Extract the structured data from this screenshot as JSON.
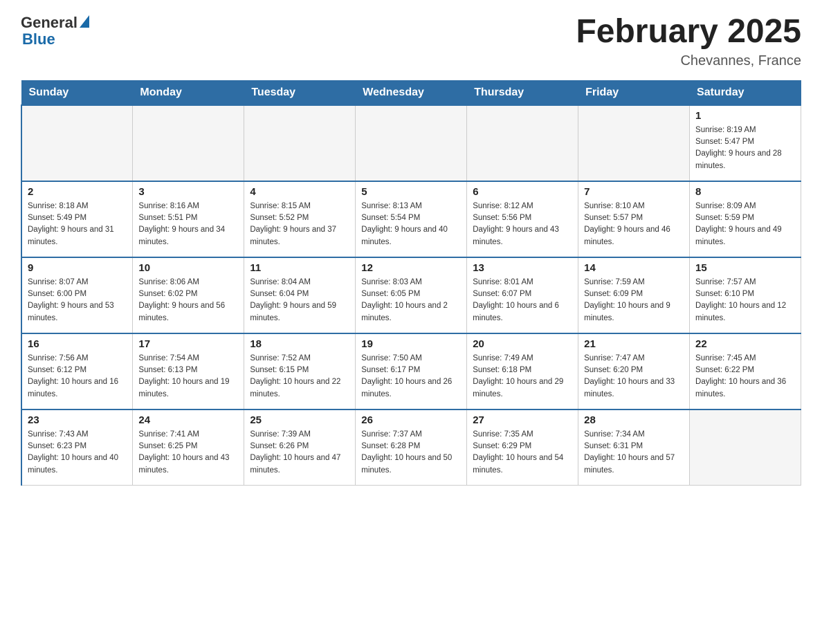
{
  "header": {
    "logo_general": "General",
    "logo_blue": "Blue",
    "month_year": "February 2025",
    "location": "Chevannes, France"
  },
  "weekdays": [
    "Sunday",
    "Monday",
    "Tuesday",
    "Wednesday",
    "Thursday",
    "Friday",
    "Saturday"
  ],
  "weeks": [
    [
      {
        "day": "",
        "info": ""
      },
      {
        "day": "",
        "info": ""
      },
      {
        "day": "",
        "info": ""
      },
      {
        "day": "",
        "info": ""
      },
      {
        "day": "",
        "info": ""
      },
      {
        "day": "",
        "info": ""
      },
      {
        "day": "1",
        "info": "Sunrise: 8:19 AM\nSunset: 5:47 PM\nDaylight: 9 hours and 28 minutes."
      }
    ],
    [
      {
        "day": "2",
        "info": "Sunrise: 8:18 AM\nSunset: 5:49 PM\nDaylight: 9 hours and 31 minutes."
      },
      {
        "day": "3",
        "info": "Sunrise: 8:16 AM\nSunset: 5:51 PM\nDaylight: 9 hours and 34 minutes."
      },
      {
        "day": "4",
        "info": "Sunrise: 8:15 AM\nSunset: 5:52 PM\nDaylight: 9 hours and 37 minutes."
      },
      {
        "day": "5",
        "info": "Sunrise: 8:13 AM\nSunset: 5:54 PM\nDaylight: 9 hours and 40 minutes."
      },
      {
        "day": "6",
        "info": "Sunrise: 8:12 AM\nSunset: 5:56 PM\nDaylight: 9 hours and 43 minutes."
      },
      {
        "day": "7",
        "info": "Sunrise: 8:10 AM\nSunset: 5:57 PM\nDaylight: 9 hours and 46 minutes."
      },
      {
        "day": "8",
        "info": "Sunrise: 8:09 AM\nSunset: 5:59 PM\nDaylight: 9 hours and 49 minutes."
      }
    ],
    [
      {
        "day": "9",
        "info": "Sunrise: 8:07 AM\nSunset: 6:00 PM\nDaylight: 9 hours and 53 minutes."
      },
      {
        "day": "10",
        "info": "Sunrise: 8:06 AM\nSunset: 6:02 PM\nDaylight: 9 hours and 56 minutes."
      },
      {
        "day": "11",
        "info": "Sunrise: 8:04 AM\nSunset: 6:04 PM\nDaylight: 9 hours and 59 minutes."
      },
      {
        "day": "12",
        "info": "Sunrise: 8:03 AM\nSunset: 6:05 PM\nDaylight: 10 hours and 2 minutes."
      },
      {
        "day": "13",
        "info": "Sunrise: 8:01 AM\nSunset: 6:07 PM\nDaylight: 10 hours and 6 minutes."
      },
      {
        "day": "14",
        "info": "Sunrise: 7:59 AM\nSunset: 6:09 PM\nDaylight: 10 hours and 9 minutes."
      },
      {
        "day": "15",
        "info": "Sunrise: 7:57 AM\nSunset: 6:10 PM\nDaylight: 10 hours and 12 minutes."
      }
    ],
    [
      {
        "day": "16",
        "info": "Sunrise: 7:56 AM\nSunset: 6:12 PM\nDaylight: 10 hours and 16 minutes."
      },
      {
        "day": "17",
        "info": "Sunrise: 7:54 AM\nSunset: 6:13 PM\nDaylight: 10 hours and 19 minutes."
      },
      {
        "day": "18",
        "info": "Sunrise: 7:52 AM\nSunset: 6:15 PM\nDaylight: 10 hours and 22 minutes."
      },
      {
        "day": "19",
        "info": "Sunrise: 7:50 AM\nSunset: 6:17 PM\nDaylight: 10 hours and 26 minutes."
      },
      {
        "day": "20",
        "info": "Sunrise: 7:49 AM\nSunset: 6:18 PM\nDaylight: 10 hours and 29 minutes."
      },
      {
        "day": "21",
        "info": "Sunrise: 7:47 AM\nSunset: 6:20 PM\nDaylight: 10 hours and 33 minutes."
      },
      {
        "day": "22",
        "info": "Sunrise: 7:45 AM\nSunset: 6:22 PM\nDaylight: 10 hours and 36 minutes."
      }
    ],
    [
      {
        "day": "23",
        "info": "Sunrise: 7:43 AM\nSunset: 6:23 PM\nDaylight: 10 hours and 40 minutes."
      },
      {
        "day": "24",
        "info": "Sunrise: 7:41 AM\nSunset: 6:25 PM\nDaylight: 10 hours and 43 minutes."
      },
      {
        "day": "25",
        "info": "Sunrise: 7:39 AM\nSunset: 6:26 PM\nDaylight: 10 hours and 47 minutes."
      },
      {
        "day": "26",
        "info": "Sunrise: 7:37 AM\nSunset: 6:28 PM\nDaylight: 10 hours and 50 minutes."
      },
      {
        "day": "27",
        "info": "Sunrise: 7:35 AM\nSunset: 6:29 PM\nDaylight: 10 hours and 54 minutes."
      },
      {
        "day": "28",
        "info": "Sunrise: 7:34 AM\nSunset: 6:31 PM\nDaylight: 10 hours and 57 minutes."
      },
      {
        "day": "",
        "info": ""
      }
    ]
  ]
}
